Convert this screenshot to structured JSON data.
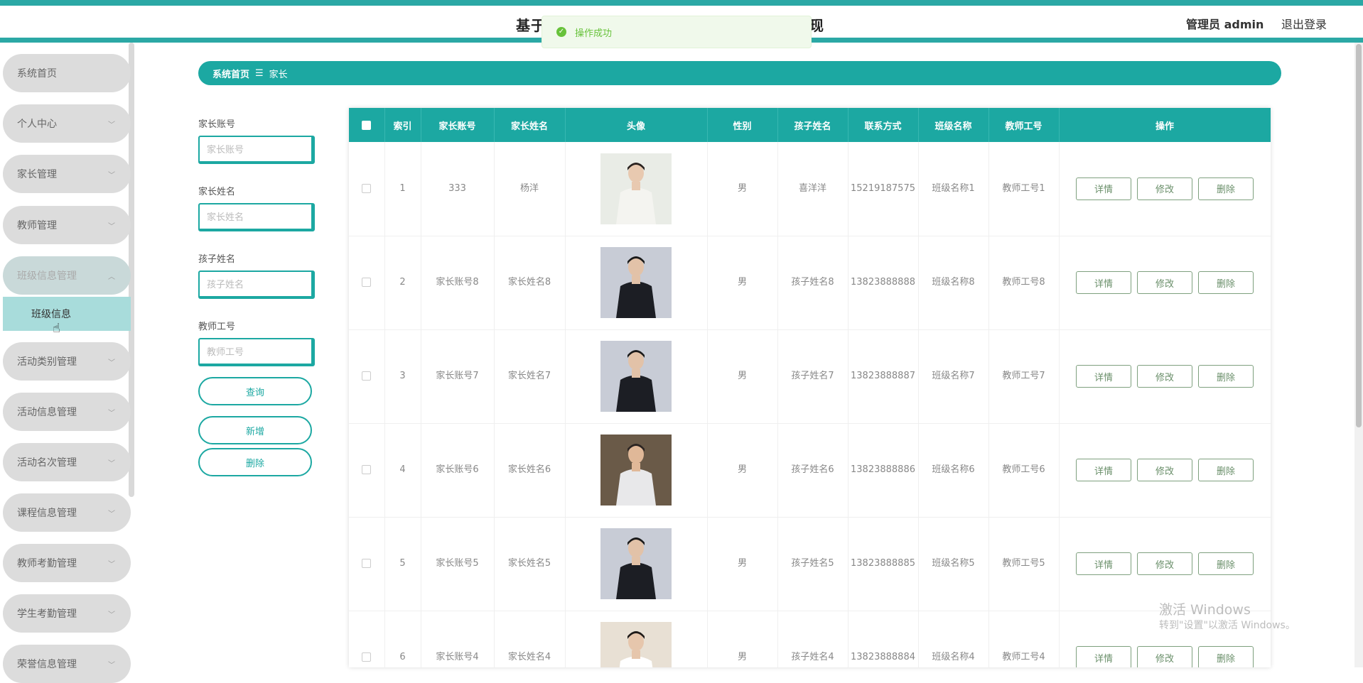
{
  "header": {
    "title_left": "基于",
    "title_right": "实现",
    "user": "管理员 admin",
    "logout": "退出登录"
  },
  "toast": {
    "message": "操作成功"
  },
  "sidebar": {
    "items": [
      {
        "label": "系统首页"
      },
      {
        "label": "个人中心"
      },
      {
        "label": "家长管理"
      },
      {
        "label": "教师管理"
      },
      {
        "label": "班级信息管理"
      },
      {
        "label": "活动类别管理"
      },
      {
        "label": "活动信息管理"
      },
      {
        "label": "活动名次管理"
      },
      {
        "label": "课程信息管理"
      },
      {
        "label": "教师考勤管理"
      },
      {
        "label": "学生考勤管理"
      },
      {
        "label": "荣誉信息管理"
      }
    ],
    "submenu": {
      "label": "班级信息"
    }
  },
  "breadcrumb": {
    "home": "系统首页",
    "sep": "☰",
    "current": "家长"
  },
  "search": {
    "fields": [
      {
        "label": "家长账号",
        "placeholder": "家长账号"
      },
      {
        "label": "家长姓名",
        "placeholder": "家长姓名"
      },
      {
        "label": "孩子姓名",
        "placeholder": "孩子姓名"
      },
      {
        "label": "教师工号",
        "placeholder": "教师工号"
      }
    ],
    "query_btn": "查询",
    "add_btn": "新增",
    "delete_btn": "删除"
  },
  "table": {
    "columns": [
      "索引",
      "家长账号",
      "家长姓名",
      "头像",
      "性别",
      "孩子姓名",
      "联系方式",
      "班级名称",
      "教师工号",
      "操作"
    ],
    "actions": {
      "detail": "详情",
      "edit": "修改",
      "delete": "删除"
    },
    "rows": [
      {
        "index": "1",
        "account": "333",
        "name": "杨洋",
        "avatar": "man-white-shirt",
        "gender": "男",
        "child": "喜洋洋",
        "phone": "15219187575",
        "class": "班级名称1",
        "teacher": "教师工号1"
      },
      {
        "index": "2",
        "account": "家长账号8",
        "name": "家长姓名8",
        "avatar": "man-black-suit",
        "gender": "男",
        "child": "孩子姓名8",
        "phone": "13823888888",
        "class": "班级名称8",
        "teacher": "教师工号8"
      },
      {
        "index": "3",
        "account": "家长账号7",
        "name": "家长姓名7",
        "avatar": "man-black-suit",
        "gender": "男",
        "child": "孩子姓名7",
        "phone": "13823888887",
        "class": "班级名称7",
        "teacher": "教师工号7"
      },
      {
        "index": "4",
        "account": "家长账号6",
        "name": "家长姓名6",
        "avatar": "woman-seated",
        "gender": "男",
        "child": "孩子姓名6",
        "phone": "13823888886",
        "class": "班级名称6",
        "teacher": "教师工号6"
      },
      {
        "index": "5",
        "account": "家长账号5",
        "name": "家长姓名5",
        "avatar": "man-black-suit",
        "gender": "男",
        "child": "孩子姓名5",
        "phone": "13823888885",
        "class": "班级名称5",
        "teacher": "教师工号5"
      },
      {
        "index": "6",
        "account": "家长账号4",
        "name": "家长姓名4",
        "avatar": "woman-white-blouse",
        "gender": "男",
        "child": "孩子姓名4",
        "phone": "13823888884",
        "class": "班级名称4",
        "teacher": "教师工号4"
      }
    ]
  },
  "watermark": {
    "line1": "激活 Windows",
    "line2": "转到\"设置\"以激活 Windows。"
  },
  "colors": {
    "accent": "#1ca8a2",
    "header_line": "#2ba8a5",
    "success": "#67c23a",
    "action_border": "#7ea07e"
  }
}
